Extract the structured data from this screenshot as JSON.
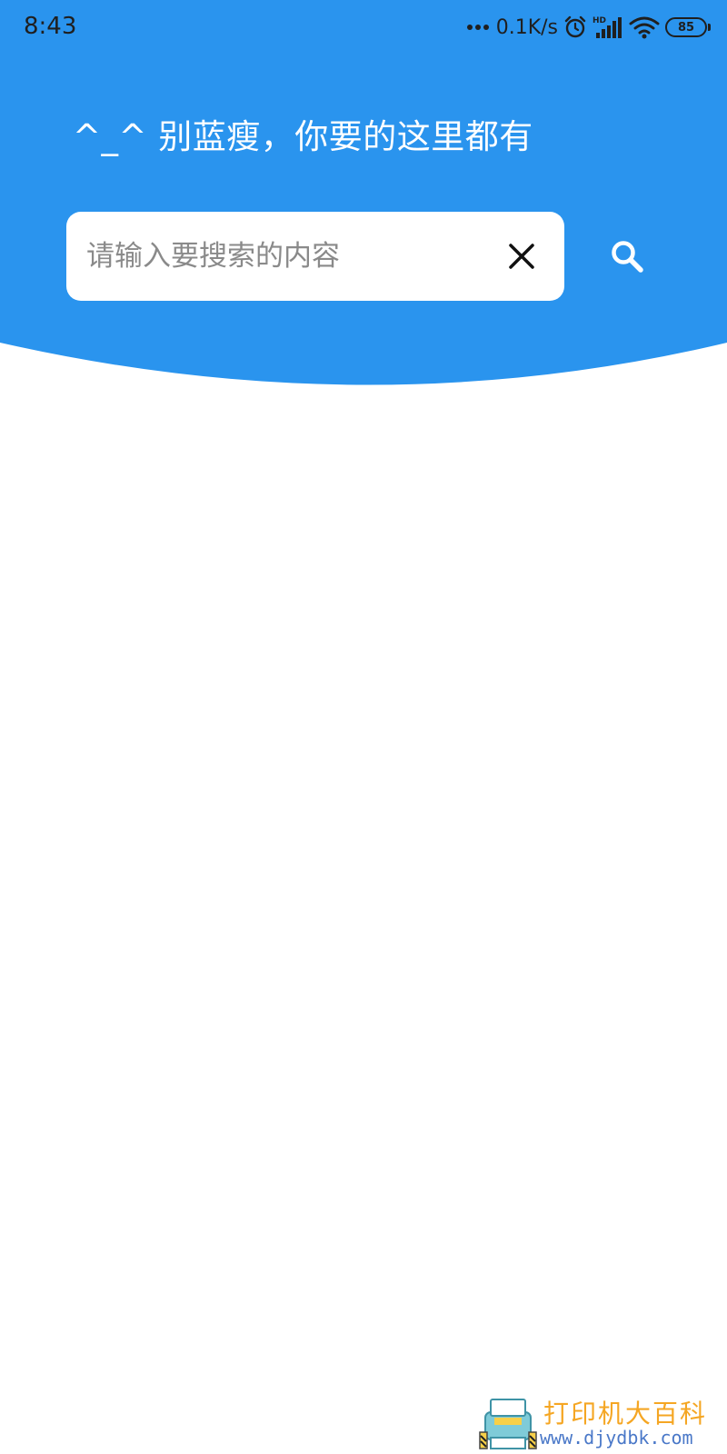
{
  "status_bar": {
    "time": "8:43",
    "net_speed": "0.1K/s",
    "battery": "85",
    "icons": [
      "more-dots-icon",
      "alarm-icon",
      "hd-signal-icon",
      "wifi-icon",
      "battery-icon"
    ]
  },
  "header": {
    "slogan": "^_^ 别蓝瘦，你要的这里都有",
    "background_color": "#2a94ee"
  },
  "search": {
    "placeholder": "请输入要搜索的内容",
    "value": "",
    "clear_icon": "close-icon",
    "submit_icon": "search-icon"
  },
  "watermark": {
    "text": "打印机大百科",
    "url": "www.djydbk.com"
  }
}
